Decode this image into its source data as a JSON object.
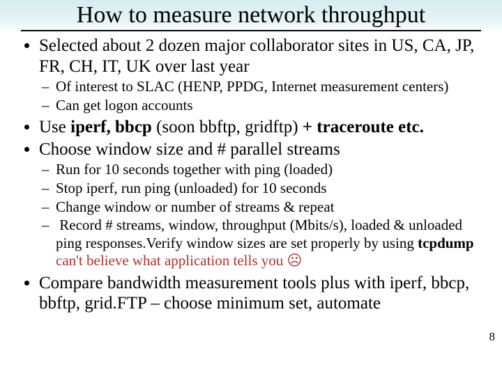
{
  "title": "How to measure network throughput",
  "bullets": {
    "b1": "Selected about 2 dozen major collaborator sites in US, CA, JP,  FR, CH, IT, UK over last year",
    "b1a": "Of interest to SLAC (HENP, PPDG, Internet measurement centers)",
    "b1b": "Can get logon accounts",
    "b2_pre": "Use ",
    "b2_bold": "iperf, bbcp",
    "b2_mid": " (soon bbftp, gridftp) ",
    "b2_bold2": "+ traceroute etc.",
    "b3": "Choose window size and # parallel streams",
    "b3a": "Run for 10 seconds together with ping (loaded)",
    "b3b": "Stop iperf, run ping (unloaded) for 10 seconds",
    "b3c": "Change window or number of streams & repeat",
    "b3d_pre": "Record # streams, window, throughput  (Mbits/s), loaded & unloaded ping responses.Verify window sizes are set  properly by using ",
    "b3d_bold": "tcpdump",
    "b3d_gap": "    ",
    "b3d_warn": "can't believe what application tells you ☹",
    "b4": "Compare bandwidth measurement tools plus with iperf, bbcp, bbftp, grid.FTP – choose minimum set, automate"
  },
  "page_number": "8"
}
